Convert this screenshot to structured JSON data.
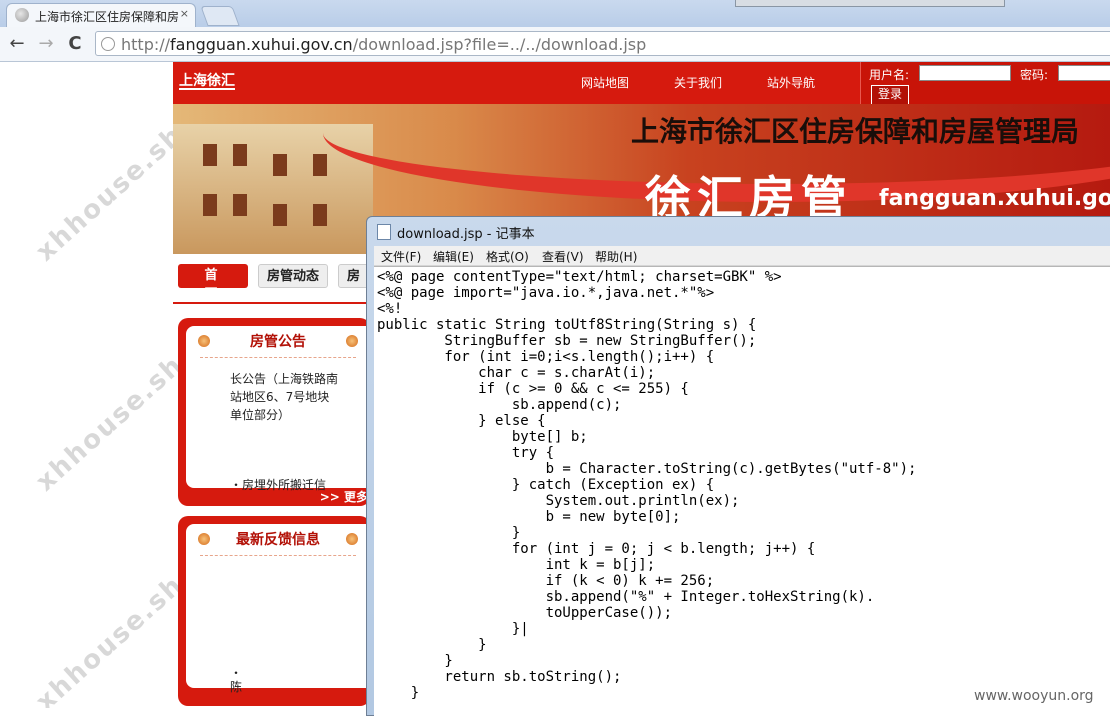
{
  "browser": {
    "tab_title": "上海市徐汇区住房保障和房",
    "tab_close": "×",
    "back_label": "←",
    "forward_label": "→",
    "reload_label": "C",
    "url_prefix": "http://",
    "url_host": "fangguan.xuhui.gov.cn",
    "url_path": "/download.jsp?file=../../download.jsp"
  },
  "site": {
    "logo_text": "上海徐汇",
    "topnav": [
      "网站地图",
      "关于我们",
      "站外导航"
    ],
    "login": {
      "username_label": "用户名:",
      "password_label": "密码:",
      "login_button": "登录"
    },
    "banner_title": "上海市徐汇区住房保障和房屋管理局",
    "banner_brand": "徐汇房管",
    "banner_domain": "fangguan.xuhui.gov.cn",
    "mainnav": [
      "首页",
      "房管动态",
      "房管"
    ],
    "watermark": "xhhouse.sh.cn",
    "panels": [
      {
        "title": "房管公告",
        "body": "长公告（上海铁路南站地区6、7号地块单位部分）",
        "cut_text": "・房埋外所搬迁信",
        "more": ">> 更多"
      },
      {
        "title": "最新反馈信息",
        "body": "",
        "cut_text": "・\n陈",
        "more": ""
      }
    ]
  },
  "notepad": {
    "title": "download.jsp - 记事本",
    "menu": [
      "文件(F)",
      "编辑(E)",
      "格式(O)",
      "查看(V)",
      "帮助(H)"
    ],
    "content": "<%@ page contentType=\"text/html; charset=GBK\" %>\n<%@ page import=\"java.io.*,java.net.*\"%>\n<%!\npublic static String toUtf8String(String s) {\n        StringBuffer sb = new StringBuffer();\n        for (int i=0;i<s.length();i++) {\n            char c = s.charAt(i);\n            if (c >= 0 && c <= 255) {\n                sb.append(c);\n            } else {\n                byte[] b;\n                try {\n                    b = Character.toString(c).getBytes(\"utf-8\");\n                } catch (Exception ex) {\n                    System.out.println(ex);\n                    b = new byte[0];\n                }\n                for (int j = 0; j < b.length; j++) {\n                    int k = b[j];\n                    if (k < 0) k += 256;\n                    sb.append(\"%\" + Integer.toHexString(k).\n                    toUpperCase());\n                }|\n            }\n        }\n        return sb.toString();\n    }"
  },
  "footer_watermark": "www.wooyun.org"
}
